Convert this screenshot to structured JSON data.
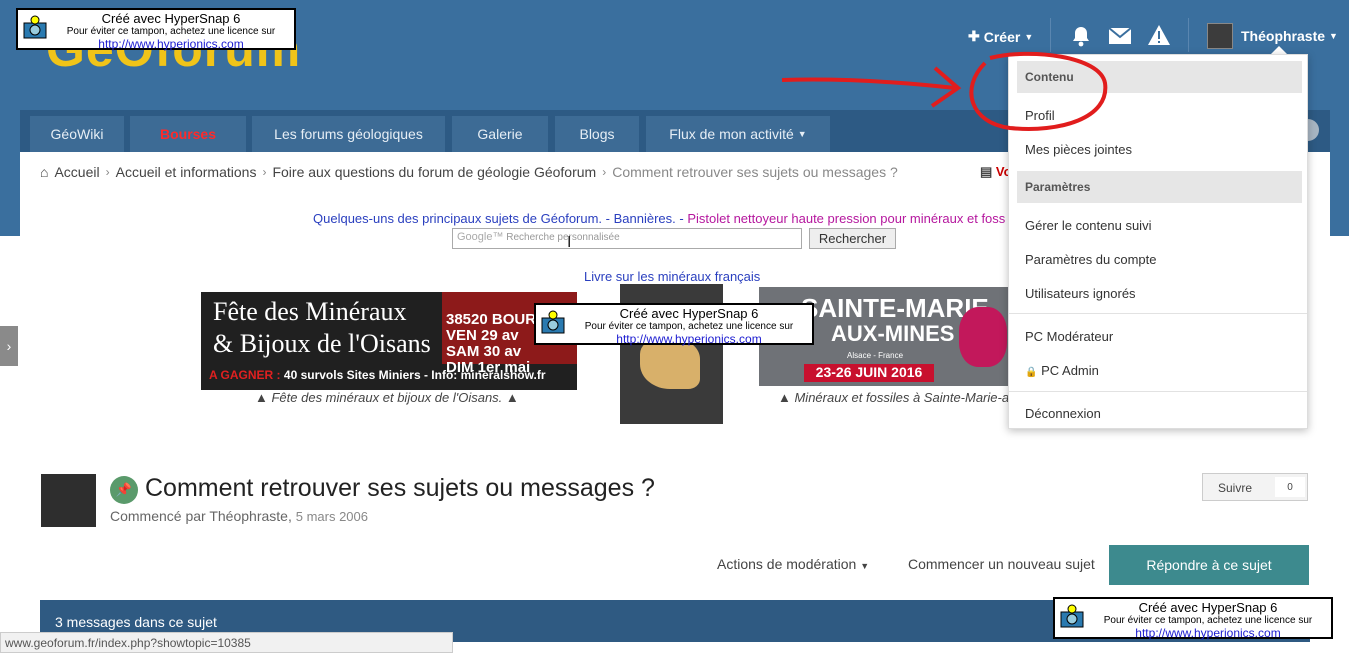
{
  "logo": {
    "text": "GéOforum"
  },
  "header": {
    "create_label": "Créer",
    "username": "Théophraste"
  },
  "nav": {
    "tabs": [
      "GéoWiki",
      "Bourses",
      "Les forums géologiques",
      "Galerie",
      "Blogs",
      "Flux de mon activité"
    ]
  },
  "breadcrumb": {
    "home": "Accueil",
    "items": [
      "Accueil et informations",
      "Foire aux questions du forum de géologie Géoforum"
    ],
    "current": "Comment retrouver ses sujets ou messages ?",
    "right_fragment": "Vo"
  },
  "links_line": {
    "a": "Quelques-uns des principaux sujets de Géoforum.",
    "sep1": " - ",
    "b": "Bannières.",
    "sep2": " - ",
    "c": "Pistolet nettoyeur haute pression pour minéraux et foss"
  },
  "search": {
    "placeholder": "Recherche personnalisée",
    "google": "Google™",
    "button": "Rechercher"
  },
  "livre_link": "Livre sur les minéraux français",
  "banner1": {
    "line1": "Fête des Minéraux",
    "line2": "& Bijoux de l'Oisans",
    "gagner": "A GAGNER :",
    "gagner_rest": " 40 survols Sites Miniers - Info: mineralshow.fr",
    "right": "38520 BOURG D'OISANS\nVEN 29 av\nSAM 30 av\nDIM 1er mai",
    "caption": "▲ Fête des minéraux et bijoux de l'Oisans. ▲"
  },
  "banner2": {
    "line1": "SAINTE-MARIE",
    "line2": "AUX-MINES",
    "sub": "Alsace - France",
    "dates": "23-26 JUIN 2016",
    "caption": "▲ Minéraux et fossiles à Sainte-Marie-a"
  },
  "topic": {
    "title": "Comment retrouver ses sujets ou messages ?",
    "started_by": "Commencé par Théophraste,",
    "date": "5 mars 2006",
    "follow_label": "Suivre",
    "follow_count": "0"
  },
  "actions": {
    "moderation": "Actions de modération",
    "new_topic": "Commencer un nouveau sujet",
    "reply": "Répondre à ce sujet"
  },
  "messages_bar": "3 messages dans ce sujet",
  "status_url": "www.geoforum.fr/index.php?showtopic=10385",
  "dropdown": {
    "head_content": "Contenu",
    "profil": "Profil",
    "attachments": "Mes pièces jointes",
    "head_settings": "Paramètres",
    "followed": "Gérer le contenu suivi",
    "account": "Paramètres du compte",
    "ignored": "Utilisateurs ignorés",
    "mod_pc": "PC Modérateur",
    "admin_pc": "PC Admin",
    "logout": "Déconnexion"
  },
  "stamp": {
    "line1": "Créé avec HyperSnap 6",
    "line2": "Pour éviter ce tampon, achetez une licence sur",
    "line3": "http://www.hyperionics.com"
  },
  "colors": {
    "header_bg": "#3a6f9e",
    "nav_bg": "#2d5a84",
    "reply_button": "#3d8a8e",
    "annotation": "#e11d1d"
  }
}
